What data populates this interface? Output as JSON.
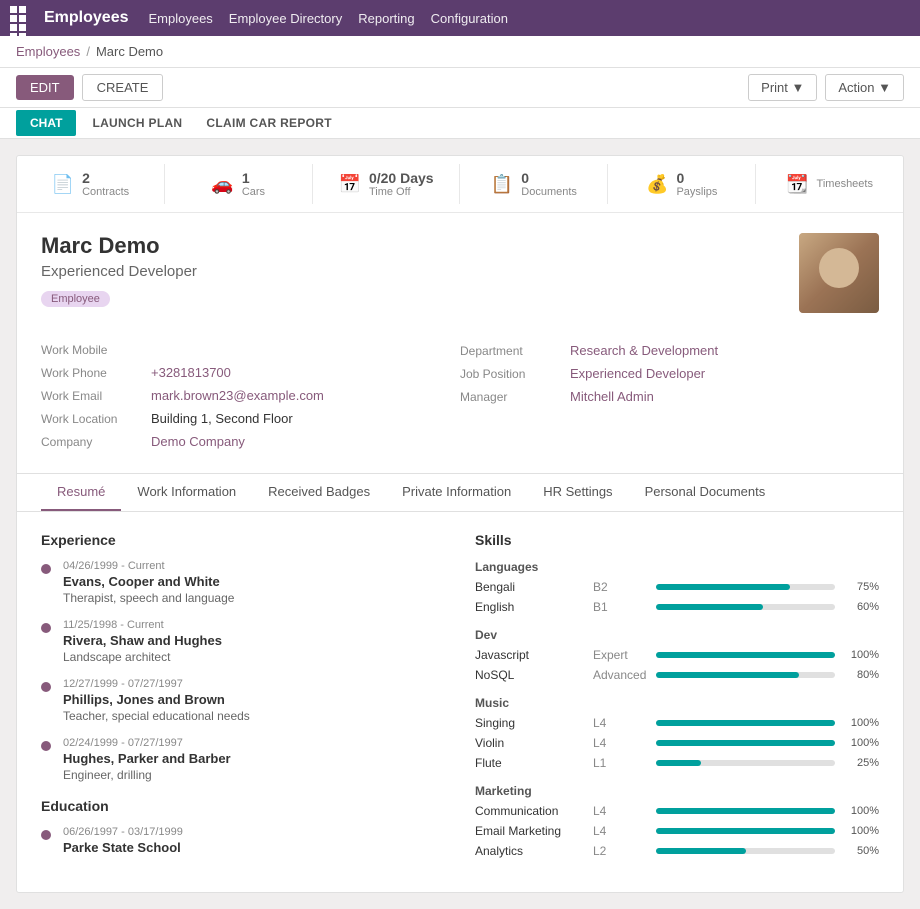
{
  "app": {
    "title": "Employees",
    "nav_items": [
      "Employees",
      "Employee Directory",
      "Reporting",
      "Configuration"
    ]
  },
  "breadcrumb": {
    "parent": "Employees",
    "current": "Marc Demo"
  },
  "toolbar": {
    "edit_label": "EDIT",
    "create_label": "CREATE",
    "print_label": "Print ▼",
    "action_label": "Action ▼"
  },
  "sub_nav": {
    "chat_label": "CHAT",
    "launch_plan_label": "LAUNCH PLAN",
    "claim_car_label": "CLAIM CAR REPORT"
  },
  "stats": [
    {
      "icon": "📄",
      "count": "2",
      "label": "Contracts"
    },
    {
      "icon": "🚗",
      "count": "1",
      "label": "Cars"
    },
    {
      "icon": "📅",
      "count": "0/20 Days",
      "label": "Time Off"
    },
    {
      "icon": "📋",
      "count": "0",
      "label": "Documents"
    },
    {
      "icon": "💰",
      "count": "0",
      "label": "Payslips"
    },
    {
      "icon": "📆",
      "count": "",
      "label": "Timesheets"
    }
  ],
  "employee": {
    "name": "Marc Demo",
    "job_title": "Experienced Developer",
    "badge": "Employee",
    "work_mobile_label": "Work Mobile",
    "work_mobile_value": "",
    "work_phone_label": "Work Phone",
    "work_phone_value": "+3281813700",
    "work_email_label": "Work Email",
    "work_email_value": "mark.brown23@example.com",
    "work_location_label": "Work Location",
    "work_location_value": "Building 1, Second Floor",
    "company_label": "Company",
    "company_value": "Demo Company",
    "department_label": "Department",
    "department_value": "Research & Development",
    "job_position_label": "Job Position",
    "job_position_value": "Experienced Developer",
    "manager_label": "Manager",
    "manager_value": "Mitchell Admin"
  },
  "tabs": [
    {
      "label": "Resumé",
      "active": true
    },
    {
      "label": "Work Information",
      "active": false
    },
    {
      "label": "Received Badges",
      "active": false
    },
    {
      "label": "Private Information",
      "active": false
    },
    {
      "label": "HR Settings",
      "active": false
    },
    {
      "label": "Personal Documents",
      "active": false
    }
  ],
  "experience": {
    "title": "Experience",
    "items": [
      {
        "date": "04/26/1999 - Current",
        "company": "Evans, Cooper and White",
        "role": "Therapist, speech and language"
      },
      {
        "date": "11/25/1998 - Current",
        "company": "Rivera, Shaw and Hughes",
        "role": "Landscape architect"
      },
      {
        "date": "12/27/1999 - 07/27/1997",
        "company": "Phillips, Jones and Brown",
        "role": "Teacher, special educational needs"
      },
      {
        "date": "02/24/1999 - 07/27/1997",
        "company": "Hughes, Parker and Barber",
        "role": "Engineer, drilling"
      }
    ]
  },
  "education": {
    "title": "Education",
    "items": [
      {
        "date": "06/26/1997 - 03/17/1999",
        "school": "Parke State School",
        "degree": ""
      }
    ]
  },
  "skills": {
    "title": "Skills",
    "groups": [
      {
        "name": "Languages",
        "items": [
          {
            "name": "Bengali",
            "level": "B2",
            "pct": 75
          },
          {
            "name": "English",
            "level": "B1",
            "pct": 60
          }
        ]
      },
      {
        "name": "Dev",
        "items": [
          {
            "name": "Javascript",
            "level": "Expert",
            "pct": 100
          },
          {
            "name": "NoSQL",
            "level": "Advanced",
            "pct": 80
          }
        ]
      },
      {
        "name": "Music",
        "items": [
          {
            "name": "Singing",
            "level": "L4",
            "pct": 100
          },
          {
            "name": "Violin",
            "level": "L4",
            "pct": 100
          },
          {
            "name": "Flute",
            "level": "L1",
            "pct": 25
          }
        ]
      },
      {
        "name": "Marketing",
        "items": [
          {
            "name": "Communication",
            "level": "L4",
            "pct": 100
          },
          {
            "name": "Email Marketing",
            "level": "L4",
            "pct": 100
          },
          {
            "name": "Analytics",
            "level": "L2",
            "pct": 50
          }
        ]
      }
    ]
  }
}
